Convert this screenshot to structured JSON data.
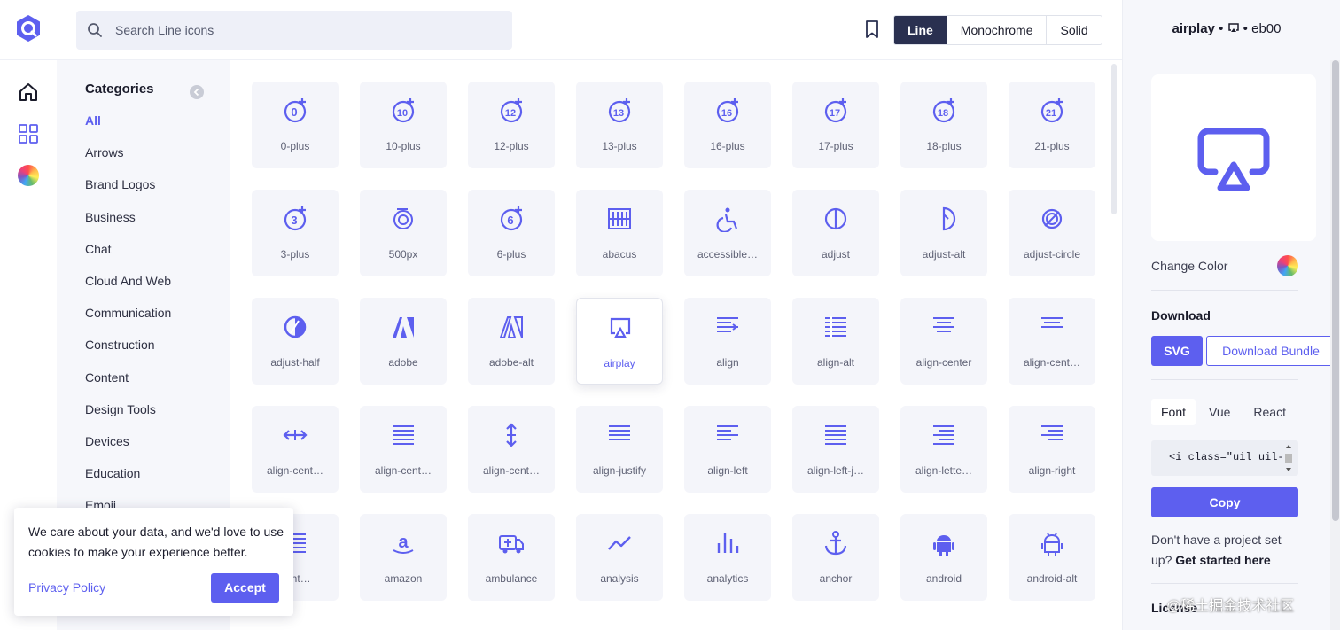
{
  "search": {
    "placeholder": "Search Line icons"
  },
  "styles": [
    "Line",
    "Monochrome",
    "Solid"
  ],
  "categories": {
    "title": "Categories",
    "items": [
      "All",
      "Arrows",
      "Brand Logos",
      "Business",
      "Chat",
      "Cloud And Web",
      "Communication",
      "Construction",
      "Content",
      "Design Tools",
      "Devices",
      "Education",
      "Emoji"
    ]
  },
  "icons": [
    "0-plus",
    "10-plus",
    "12-plus",
    "13-plus",
    "16-plus",
    "17-plus",
    "18-plus",
    "21-plus",
    "3-plus",
    "500px",
    "6-plus",
    "abacus",
    "accessible…",
    "adjust",
    "adjust-alt",
    "adjust-circle",
    "adjust-half",
    "adobe",
    "adobe-alt",
    "airplay",
    "align",
    "align-alt",
    "align-center",
    "align-cent…",
    "align-cent…",
    "align-cent…",
    "align-cent…",
    "align-justify",
    "align-left",
    "align-left-j…",
    "align-lette…",
    "align-right",
    "right…",
    "amazon",
    "ambulance",
    "analysis",
    "analytics",
    "anchor",
    "android",
    "android-alt"
  ],
  "panel": {
    "name": "airplay",
    "sep": "•",
    "code": "eb00",
    "change_color": "Change Color",
    "download_title": "Download",
    "svg_button": "SVG",
    "bundle_button": "Download Bundle",
    "tabs": [
      "Font",
      "Vue",
      "React"
    ],
    "snippet": "<i class=\"uil uil-",
    "copy_button": "Copy",
    "help_text": "Don't have a project set up?",
    "help_link": "Get started here",
    "license": "License"
  },
  "cookie": {
    "text": "We care about your data, and we'd love to use cookies to make your experience better.",
    "privacy": "Privacy Policy",
    "accept": "Accept"
  },
  "watermark": "@稀土掘金技术社区",
  "colors": {
    "accent": "#5d5fef",
    "dark": "#2a3050"
  }
}
